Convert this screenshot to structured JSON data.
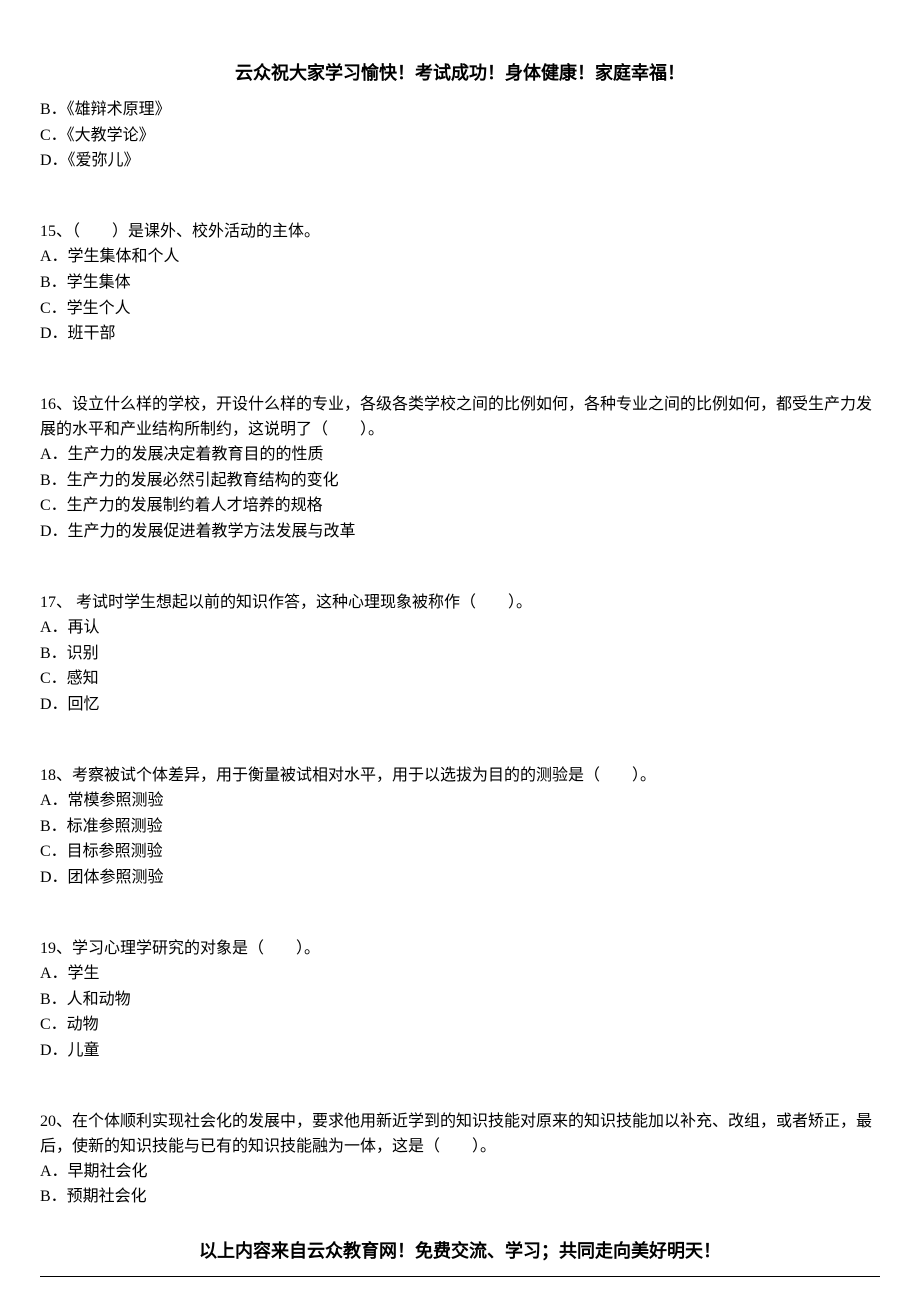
{
  "header": "云众祝大家学习愉快！考试成功！身体健康！家庭幸福！",
  "footer": "以上内容来自云众教育网！免费交流、学习；共同走向美好明天！",
  "top_options": {
    "b": "B．《雄辩术原理》",
    "c": "C．《大教学论》",
    "d": "D．《爱弥儿》"
  },
  "q15": {
    "stem": "15、（　　）是课外、校外活动的主体。",
    "a": "A．学生集体和个人",
    "b": "B．学生集体",
    "c": "C．学生个人",
    "d": "D．班干部"
  },
  "q16": {
    "stem": "16、设立什么样的学校，开设什么样的专业，各级各类学校之间的比例如何，各种专业之间的比例如何，都受生产力发展的水平和产业结构所制约，这说明了（　　）。",
    "a": "A．生产力的发展决定着教育目的的性质",
    "b": "B．生产力的发展必然引起教育结构的变化",
    "c": "C．生产力的发展制约着人才培养的规格",
    "d": "D．生产力的发展促进着教学方法发展与改革"
  },
  "q17": {
    "stem": "17、 考试时学生想起以前的知识作答，这种心理现象被称作（　　）。",
    "a": "A．再认",
    "b": "B．识别",
    "c": "C．感知",
    "d": "D．回忆"
  },
  "q18": {
    "stem": "18、考察被试个体差异，用于衡量被试相对水平，用于以选拔为目的的测验是（　　）。",
    "a": "A．常模参照测验",
    "b": "B．标准参照测验",
    "c": "C．目标参照测验",
    "d": "D．团体参照测验"
  },
  "q19": {
    "stem": "19、学习心理学研究的对象是（　　）。",
    "a": "A．学生",
    "b": "B．人和动物",
    "c": "C．动物",
    "d": "D．儿童"
  },
  "q20": {
    "stem": "20、在个体顺利实现社会化的发展中，要求他用新近学到的知识技能对原来的知识技能加以补充、改组，或者矫正，最后，使新的知识技能与已有的知识技能融为一体，这是（　　）。",
    "a": "A．早期社会化",
    "b": "B．预期社会化"
  }
}
